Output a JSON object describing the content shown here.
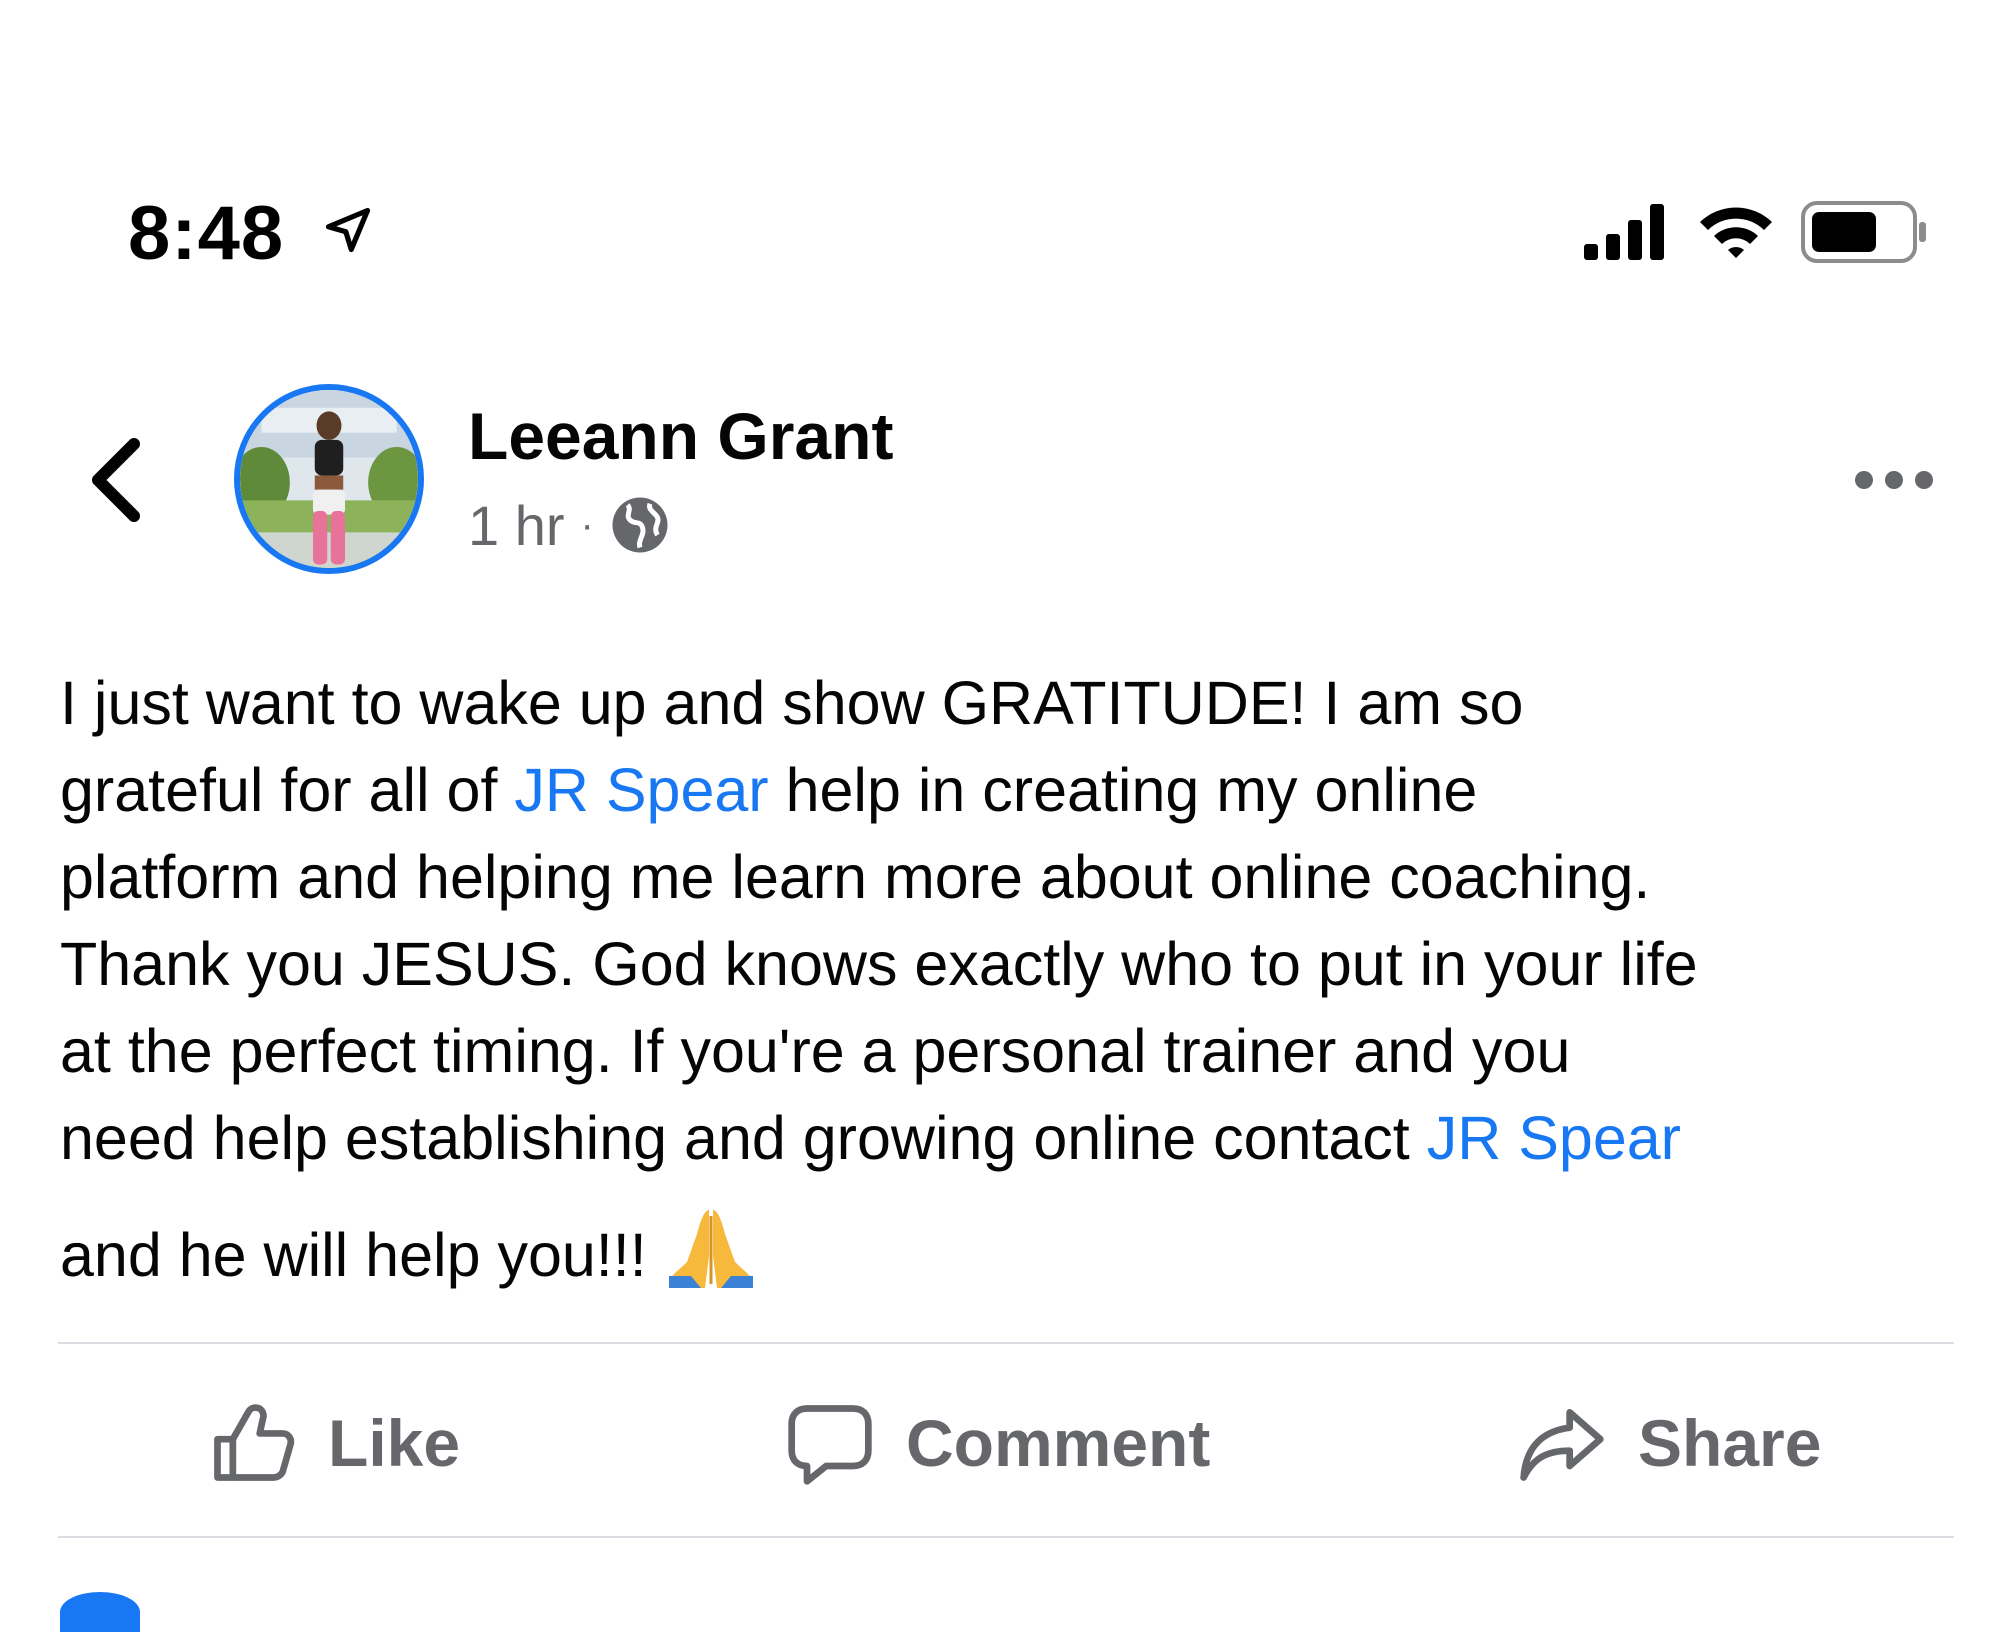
{
  "status_bar": {
    "time": "8:48",
    "icons": [
      "location-arrow-icon",
      "cellular-signal-icon",
      "wifi-icon",
      "battery-icon"
    ]
  },
  "post": {
    "author": "Leeann Grant",
    "timestamp": "1 hr",
    "separator": "·",
    "privacy_icon": "globe-icon",
    "body_lines": [
      [
        {
          "text": "I just want to wake up and show GRATITUDE! I am so"
        }
      ],
      [
        {
          "text": "grateful for all of "
        },
        {
          "text": "JR Spear",
          "mention": true
        },
        {
          "text": " help in creating my online"
        }
      ],
      [
        {
          "text": "platform and helping me learn more about online coaching."
        }
      ],
      [
        {
          "text": "Thank you JESUS. God knows exactly who to put in your life"
        }
      ],
      [
        {
          "text": "at the perfect timing. If you're a personal trainer and you"
        }
      ],
      [
        {
          "text": "need help establishing and growing online contact "
        },
        {
          "text": "JR Spear",
          "mention": true
        }
      ],
      [
        {
          "text": "and he will help you!!!"
        }
      ]
    ],
    "emoji_icon": "folded-hands-icon"
  },
  "actions": {
    "like": "Like",
    "comment": "Comment",
    "share": "Share"
  },
  "colors": {
    "accent": "#1877f2",
    "secondary_text": "#65676b",
    "divider": "#dadde1"
  }
}
